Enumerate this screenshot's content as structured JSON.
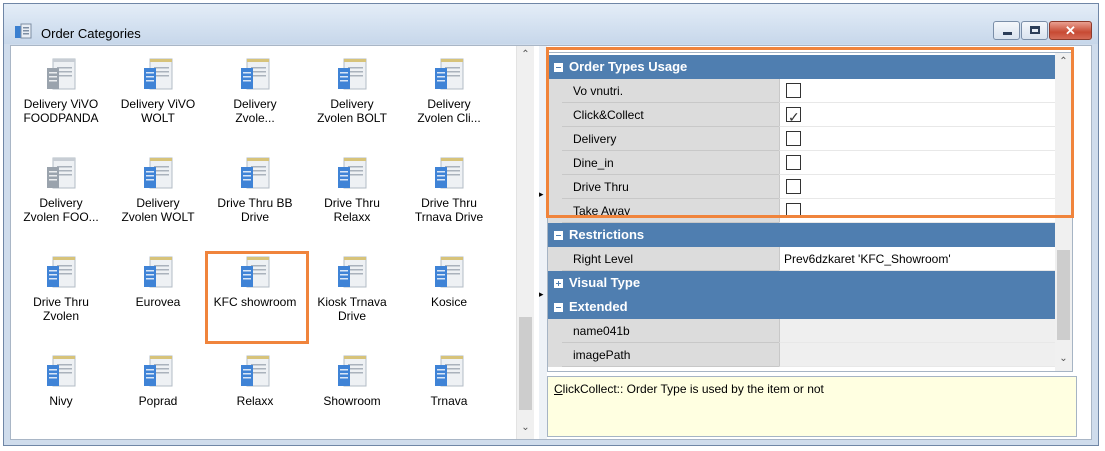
{
  "window": {
    "title": "Order Categories",
    "close_glyph": "✕"
  },
  "colors": {
    "highlight": "#f0843c",
    "category_bg": "#4f7eb0",
    "desc_bg": "#ffffe1"
  },
  "categories": [
    {
      "line1": "Delivery ViVO",
      "line2": "FOODPANDA",
      "icon": "order-doc-icon-gray"
    },
    {
      "line1": "Delivery ViVO",
      "line2": "WOLT",
      "icon": "order-doc-icon"
    },
    {
      "line1": "Delivery",
      "line2": "Zvole...",
      "icon": "order-doc-icon"
    },
    {
      "line1": "Delivery",
      "line2": "Zvolen BOLT",
      "icon": "order-doc-icon"
    },
    {
      "line1": "Delivery",
      "line2": "Zvolen Cli...",
      "icon": "order-doc-icon"
    },
    {
      "line1": "Delivery",
      "line2": "Zvolen FOO...",
      "icon": "order-doc-icon-gray"
    },
    {
      "line1": "Delivery",
      "line2": "Zvolen WOLT",
      "icon": "order-doc-icon"
    },
    {
      "line1": "Drive Thru BB",
      "line2": "Drive",
      "icon": "order-doc-icon"
    },
    {
      "line1": "Drive Thru",
      "line2": "Relaxx",
      "icon": "order-doc-icon"
    },
    {
      "line1": "Drive Thru",
      "line2": "Trnava Drive",
      "icon": "order-doc-icon"
    },
    {
      "line1": "Drive Thru",
      "line2": "Zvolen",
      "icon": "order-doc-icon"
    },
    {
      "line1": "Eurovea",
      "line2": "",
      "icon": "order-doc-icon"
    },
    {
      "line1": "KFC showroom",
      "line2": "",
      "icon": "order-doc-icon"
    },
    {
      "line1": "Kiosk Trnava",
      "line2": "Drive",
      "icon": "order-doc-icon"
    },
    {
      "line1": "Kosice",
      "line2": "",
      "icon": "order-doc-icon"
    },
    {
      "line1": "Nivy",
      "line2": "",
      "icon": "order-doc-icon"
    },
    {
      "line1": "Poprad",
      "line2": "",
      "icon": "order-doc-icon"
    },
    {
      "line1": "Relaxx",
      "line2": "",
      "icon": "order-doc-icon"
    },
    {
      "line1": "Showroom",
      "line2": "",
      "icon": "order-doc-icon"
    },
    {
      "line1": "Trnava",
      "line2": "",
      "icon": "order-doc-icon"
    }
  ],
  "properties": {
    "order_types_usage": {
      "title": "Order Types Usage",
      "items": [
        {
          "label": "Vo vnutri.",
          "checked": false
        },
        {
          "label": "Click&Collect",
          "checked": true
        },
        {
          "label": "Delivery",
          "checked": false
        },
        {
          "label": "Dine_in",
          "checked": false
        },
        {
          "label": "Drive Thru",
          "checked": false
        },
        {
          "label": "Take Away",
          "checked": false
        }
      ]
    },
    "restrictions": {
      "title": "Restrictions",
      "right_level_label": "Right Level",
      "right_level_value": "Prev6dzkaret 'KFC_Showroom'"
    },
    "visual_type": {
      "title": "Visual Type"
    },
    "extended": {
      "title": "Extended",
      "items": [
        {
          "label": "name041b"
        },
        {
          "label": "imagePath"
        }
      ]
    }
  },
  "description": "ClickCollect:: Order Type is used by the item or not",
  "description_underlined": "C",
  "description_rest": "lickCollect:: Order Type is used by the item or not"
}
